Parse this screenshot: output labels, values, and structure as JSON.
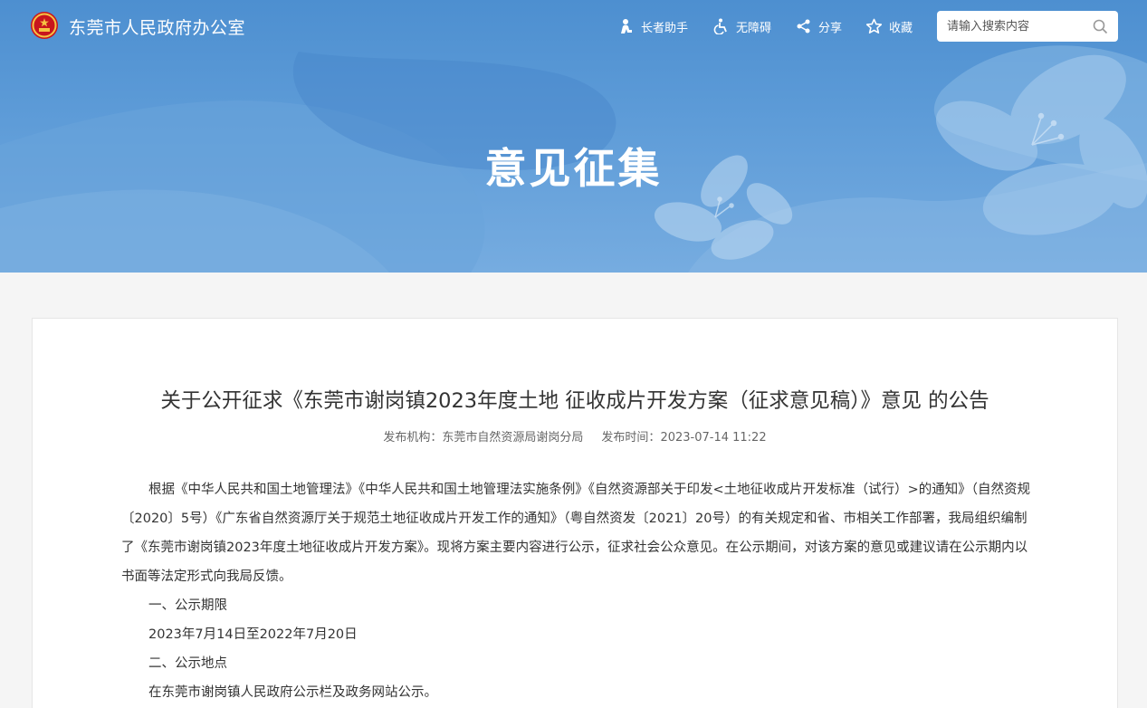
{
  "header": {
    "site_title": "东莞市人民政府办公室",
    "tools": [
      {
        "label": "长者助手",
        "icon": "elder-assistant-icon"
      },
      {
        "label": "无障碍",
        "icon": "accessibility-icon"
      },
      {
        "label": "分享",
        "icon": "share-icon"
      },
      {
        "label": "收藏",
        "icon": "star-icon"
      }
    ],
    "search_placeholder": "请输入搜索内容"
  },
  "hero": {
    "title": "意见征集"
  },
  "article": {
    "title": "关于公开征求《东莞市谢岗镇2023年度土地 征收成片开发方案（征求意见稿）》意见 的公告",
    "publisher_label": "发布机构：",
    "publisher": "东莞市自然资源局谢岗分局",
    "time_label": "发布时间：",
    "time": "2023-07-14 11:22",
    "paragraph1": "根据《中华人民共和国土地管理法》《中华人民共和国土地管理法实施条例》《自然资源部关于印发<土地征收成片开发标准（试行）>的通知》（自然资规〔2020〕5号）《广东省自然资源厅关于规范土地征收成片开发工作的通知》（粤自然资发〔2021〕20号）的有关规定和省、市相关工作部署，我局组织编制了《东莞市谢岗镇2023年度土地征收成片开发方案》。现将方案主要内容进行公示，征求社会公众意见。在公示期间，对该方案的意见或建议请在公示期内以书面等法定形式向我局反馈。",
    "section1_heading": "一、公示期限",
    "section1_content": "2023年7月14日至2022年7月20日",
    "section2_heading": "二、公示地点",
    "section2_content": "在东莞市谢岗镇人民政府公示栏及政务网站公示。"
  },
  "colors": {
    "hero_blue": "#5e9cd8",
    "page_bg": "#f5f5f5"
  }
}
